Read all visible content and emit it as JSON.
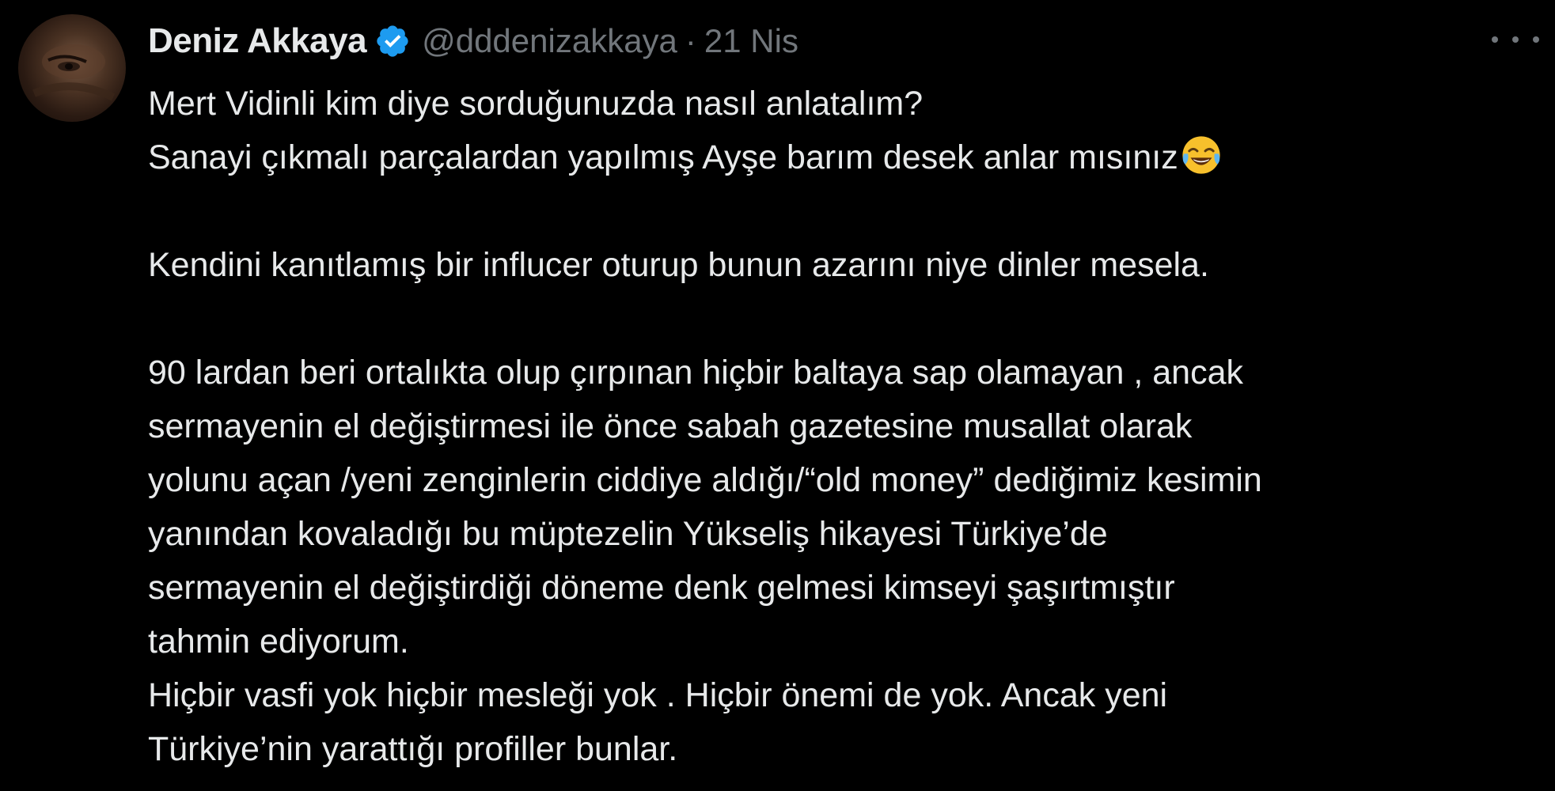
{
  "tweet": {
    "display_name": "Deniz Akkaya",
    "handle": "@dddenizakkaya",
    "separator": "·",
    "date": "21 Nis",
    "lines": [
      "Mert Vidinli kim diye sorduğunuzda nasıl anlatalım?",
      "Sanayi çıkmalı parçalardan yapılmış Ayşe barım desek anlar mısınız",
      "Kendini kanıtlamış bir influcer oturup bunun azarını niye dinler mesela.",
      "90 lardan beri ortalıkta olup çırpınan hiçbir baltaya sap olamayan , ancak",
      "sermayenin el değiştirmesi ile önce sabah gazetesine musallat olarak",
      "yolunu açan /yeni zenginlerin ciddiye aldığı/“old money” dediğimiz kesimin",
      "yanından kovaladığı bu müptezelin   Yükseliş hikayesi Türkiye’de",
      "sermayenin el değiştirdiği  döneme denk gelmesi kimseyi şaşırtmıştır",
      "tahmin ediyorum.",
      "Hiçbir vasfi yok hiçbir mesleği yok . Hiçbir önemi de yok. Ancak yeni",
      "Türkiye’nin yarattığı profiller bunlar."
    ],
    "emoji": "face-with-tears-of-joy-icon"
  },
  "colors": {
    "background": "#000000",
    "text": "#e7e9ea",
    "secondary": "#71767b",
    "verified": "#1d9bf0"
  }
}
